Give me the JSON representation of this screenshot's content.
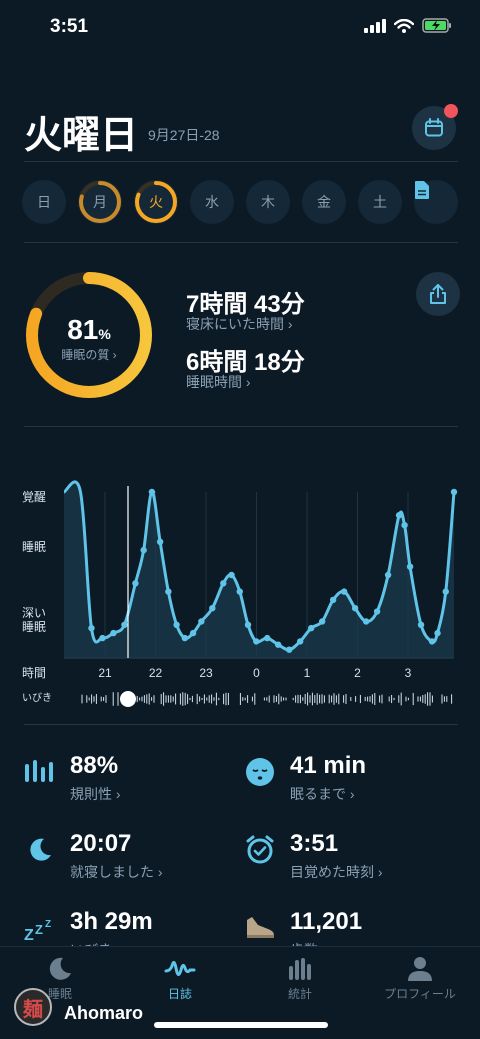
{
  "status_bar": {
    "time": "3:51"
  },
  "header": {
    "day": "火曜日",
    "date_range": "9月27日-28"
  },
  "week": [
    "日",
    "月",
    "火",
    "水",
    "木",
    "金",
    "土"
  ],
  "summary": {
    "quality_value": "81",
    "quality_unit": "%",
    "quality_label": "睡眠の質 ›",
    "quality_fraction": 0.81,
    "in_bed_value": "7時間 43分",
    "in_bed_label": "寝床にいた時間 ›",
    "asleep_value": "6時間 18分",
    "asleep_label": "睡眠時間 ›"
  },
  "chart_data": {
    "type": "area",
    "y_labels": [
      "覚醒",
      "睡眠",
      "深い\n睡眠"
    ],
    "x_label": "時間",
    "x_ticks": [
      "21",
      "22",
      "23",
      "0",
      "1",
      "2",
      "3"
    ],
    "snore_label": "いびき",
    "ylim": [
      0,
      100
    ],
    "x": [
      20.7,
      21.0,
      21.2,
      21.4,
      21.6,
      21.8,
      22.0,
      22.15,
      22.3,
      22.45,
      22.6,
      22.75,
      22.9,
      23.05,
      23.2,
      23.4,
      23.6,
      23.75,
      23.9,
      24.05,
      24.2,
      24.4,
      24.6,
      24.8,
      25.0,
      25.2,
      25.4,
      25.6,
      25.8,
      26.0,
      26.2,
      26.4,
      26.6,
      26.8,
      26.9,
      27.0,
      27.2,
      27.4,
      27.5,
      27.65,
      27.8
    ],
    "values": [
      100,
      100,
      18,
      12,
      15,
      20,
      45,
      65,
      100,
      70,
      40,
      20,
      12,
      15,
      22,
      30,
      45,
      50,
      40,
      20,
      10,
      12,
      8,
      5,
      10,
      18,
      22,
      35,
      40,
      30,
      22,
      28,
      50,
      86,
      80,
      55,
      20,
      10,
      15,
      40,
      100
    ]
  },
  "metrics": [
    {
      "icon": "bars-icon",
      "value": "88%",
      "label": "規則性 ›"
    },
    {
      "icon": "sleepy-face-icon",
      "value": "41 min",
      "label": "眠るまで ›"
    },
    {
      "icon": "moon-icon",
      "value": "20:07",
      "label": "就寝しました ›"
    },
    {
      "icon": "alarm-clock-icon",
      "value": "3:51",
      "label": "目覚めた時刻 ›"
    },
    {
      "icon": "snore-icon",
      "value": "3h 29m",
      "label": "いびき ›"
    },
    {
      "icon": "shoe-icon",
      "value": "11,201",
      "label": "歩数 ›"
    }
  ],
  "tabs": [
    {
      "label": "睡眠",
      "active": false
    },
    {
      "label": "日誌",
      "active": true
    },
    {
      "label": "統計",
      "active": false
    },
    {
      "label": "プロフィール",
      "active": false
    }
  ],
  "watermark": {
    "seal_char": "麺",
    "name": "Ahomaro"
  },
  "colors": {
    "accent": "#f5a623",
    "chart": "#5fc4e8",
    "background": "#0c1a26",
    "badge": "#f2545b"
  }
}
